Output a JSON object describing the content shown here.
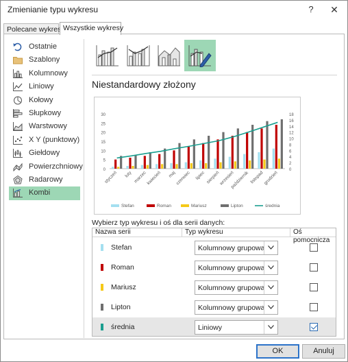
{
  "dialog": {
    "title": "Zmienianie typu wykresu",
    "help_label": "?",
    "close_label": "✕",
    "ok_label": "OK",
    "cancel_label": "Anuluj"
  },
  "tabs": [
    {
      "label": "Polecane wykresy",
      "selected": false
    },
    {
      "label": "Wszystkie wykresy",
      "selected": true
    }
  ],
  "sidebar": {
    "items": [
      {
        "label": "Ostatnie",
        "icon": "undo-icon"
      },
      {
        "label": "Szablony",
        "icon": "folder-icon"
      },
      {
        "label": "Kolumnowy",
        "icon": "column-chart-icon"
      },
      {
        "label": "Liniowy",
        "icon": "line-chart-icon"
      },
      {
        "label": "Kołowy",
        "icon": "pie-chart-icon"
      },
      {
        "label": "Słupkowy",
        "icon": "bar-chart-icon"
      },
      {
        "label": "Warstwowy",
        "icon": "area-chart-icon"
      },
      {
        "label": "X Y (punktowy)",
        "icon": "scatter-chart-icon"
      },
      {
        "label": "Giełdowy",
        "icon": "stock-chart-icon"
      },
      {
        "label": "Powierzchniowy",
        "icon": "surface-chart-icon"
      },
      {
        "label": "Radarowy",
        "icon": "radar-chart-icon"
      },
      {
        "label": "Kombi",
        "icon": "combo-chart-icon",
        "selected": true
      }
    ]
  },
  "subtypes": {
    "items": [
      {
        "icon": "clustered-column-line-icon"
      },
      {
        "icon": "clustered-column-line-secondary-axis-icon"
      },
      {
        "icon": "stacked-area-clustered-column-icon"
      },
      {
        "icon": "custom-combination-icon",
        "selected": true
      }
    ],
    "selected_title": "Niestandardowy złożony"
  },
  "series_section": {
    "label": "Wybierz typ wykresu i oś dla serii danych:",
    "headers": {
      "name": "Nazwa serii",
      "type": "Typ wykresu",
      "secondary": "Oś pomocnicza"
    },
    "rows": [
      {
        "name": "Stefan",
        "color": "#a4dff0",
        "type": "Kolumnowy grupowa...",
        "secondary": false
      },
      {
        "name": "Roman",
        "color": "#c00000",
        "type": "Kolumnowy grupowa...",
        "secondary": false
      },
      {
        "name": "Mariusz",
        "color": "#f5c918",
        "type": "Kolumnowy grupowa...",
        "secondary": false
      },
      {
        "name": "Lipton",
        "color": "#6f6f6f",
        "type": "Kolumnowy grupowa...",
        "secondary": false
      },
      {
        "name": "średnia",
        "color": "#1a9e8f",
        "type": "Liniowy",
        "secondary": true,
        "selected": true
      }
    ]
  },
  "chart_data": {
    "type": "bar",
    "categories": [
      "styczeń",
      "luty",
      "marzec",
      "kwiecień",
      "maj",
      "czerwiec",
      "lipiec",
      "sierpień",
      "wrzesień",
      "październik",
      "listopad",
      "grudzień"
    ],
    "series": [
      {
        "name": "Stefan",
        "values": [
          1,
          1.5,
          2,
          2.5,
          3,
          3.5,
          4.5,
          5.5,
          6.5,
          8,
          9,
          11
        ],
        "color": "#a4dff0",
        "axis": "primary",
        "type": "column"
      },
      {
        "name": "Roman",
        "values": [
          5,
          6,
          7,
          8,
          10,
          12,
          14,
          16,
          18,
          20,
          22,
          24
        ],
        "color": "#c00000",
        "axis": "primary",
        "type": "column"
      },
      {
        "name": "Mariusz",
        "values": [
          1,
          1.5,
          2,
          2.5,
          2.5,
          3,
          3,
          3.5,
          4,
          4.5,
          5,
          5.5
        ],
        "color": "#f5c918",
        "axis": "primary",
        "type": "column"
      },
      {
        "name": "Lipton",
        "values": [
          7,
          7.5,
          9,
          11,
          14,
          16,
          18,
          20,
          22,
          24,
          26,
          27
        ],
        "color": "#6f6f6f",
        "axis": "primary",
        "type": "column"
      },
      {
        "name": "średnia",
        "values": [
          3.5,
          4.2,
          5,
          5.7,
          6.6,
          7.4,
          8.3,
          9.2,
          10.5,
          12,
          13.6,
          15.2
        ],
        "color": "#1a9e8f",
        "axis": "secondary",
        "type": "line"
      }
    ],
    "primary_axis": {
      "ylim": [
        0,
        30
      ],
      "ticks": [
        "0",
        "5",
        "10",
        "15",
        "20",
        "25",
        "30"
      ]
    },
    "secondary_axis": {
      "ylim": [
        0,
        18
      ],
      "ticks": [
        "0",
        "2",
        "4",
        "6",
        "8",
        "10",
        "12",
        "14",
        "16",
        "18"
      ]
    },
    "gridlines": false,
    "legend_position": "bottom",
    "legend": [
      "Stefan",
      "Roman",
      "Mariusz",
      "Lipton",
      "średnia"
    ]
  }
}
